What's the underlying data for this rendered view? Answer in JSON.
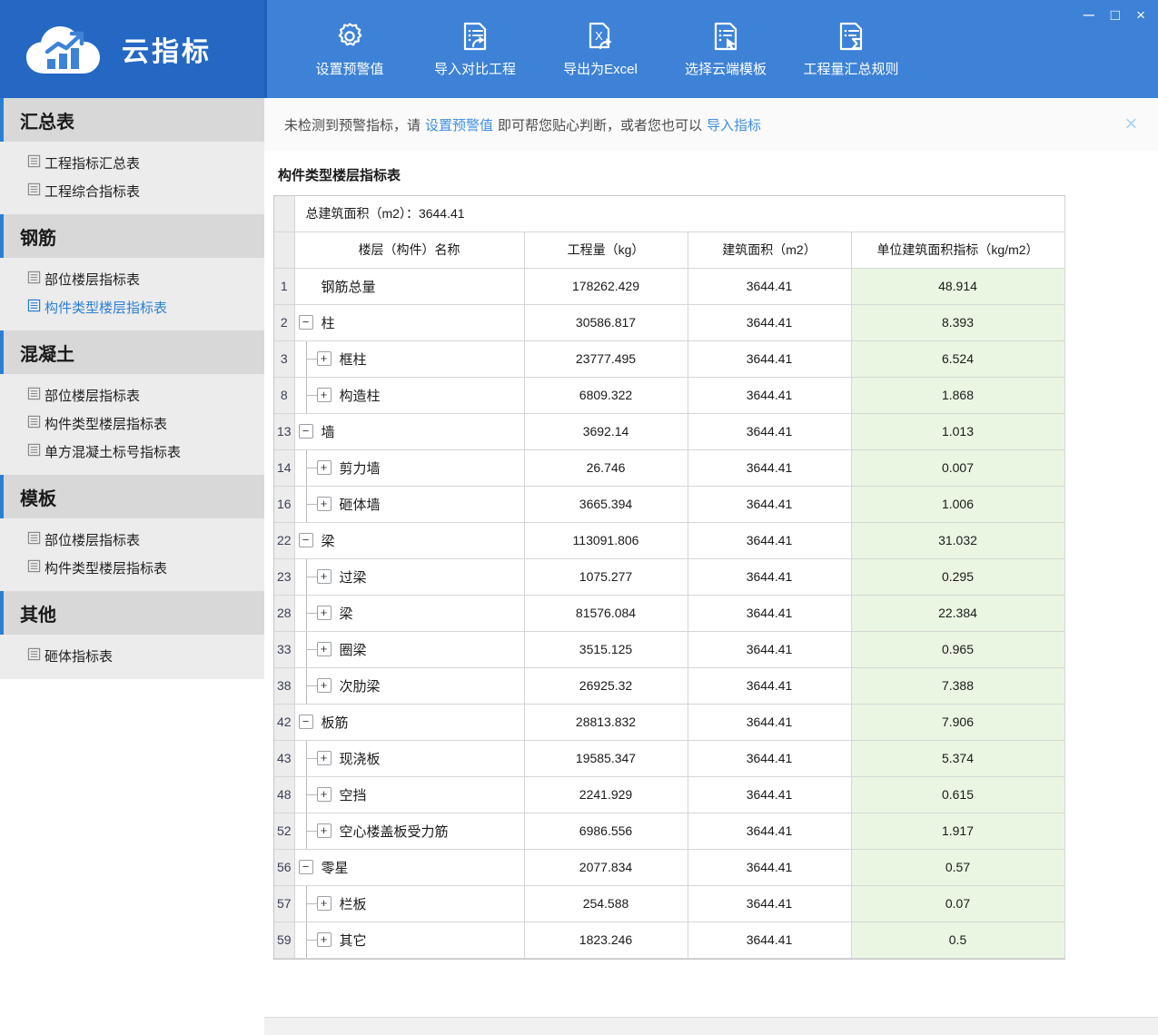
{
  "window": {
    "minimize_label": "─",
    "maximize_label": "□",
    "close_label": "×"
  },
  "brand": {
    "title": "云指标",
    "logo_icon": "cloud-chart-logo",
    "bg_color": "#2468c4"
  },
  "toolbar": {
    "bg_color": "#3d82d6",
    "items": [
      {
        "label": "设置预警值",
        "icon": "gear-icon"
      },
      {
        "label": "导入对比工程",
        "icon": "document-import-icon"
      },
      {
        "label": "导出为Excel",
        "icon": "excel-export-icon"
      },
      {
        "label": "选择云端模板",
        "icon": "document-cursor-icon"
      },
      {
        "label": "工程量汇总规则",
        "icon": "document-sigma-icon"
      }
    ]
  },
  "notice": {
    "text_1": "未检测到预警指标，请",
    "link_1": "设置预警值",
    "text_2": "即可帮您贴心判断，或者您也可以",
    "link_2": "导入指标",
    "close_label": "✕",
    "link_color": "#3f8fe0"
  },
  "sidebar": {
    "groups": [
      {
        "title": "汇总表",
        "items": [
          {
            "label": "工程指标汇总表",
            "active": false
          },
          {
            "label": "工程综合指标表",
            "active": false
          }
        ]
      },
      {
        "title": "钢筋",
        "items": [
          {
            "label": "部位楼层指标表",
            "active": false
          },
          {
            "label": "构件类型楼层指标表",
            "active": true
          }
        ]
      },
      {
        "title": "混凝土",
        "items": [
          {
            "label": "部位楼层指标表",
            "active": false
          },
          {
            "label": "构件类型楼层指标表",
            "active": false
          },
          {
            "label": "单方混凝土标号指标表",
            "active": false
          }
        ]
      },
      {
        "title": "模板",
        "items": [
          {
            "label": "部位楼层指标表",
            "active": false
          },
          {
            "label": "构件类型楼层指标表",
            "active": false
          }
        ]
      },
      {
        "title": "其他",
        "items": [
          {
            "label": "砸体指标表",
            "active": false
          }
        ]
      }
    ]
  },
  "main": {
    "panel_title": "构件类型楼层指标表",
    "summary_row": "总建筑面积（m2）：3644.41",
    "columns": [
      "楼层（构件）名称",
      "工程量（kg）",
      "建筑面积（m2）",
      "单位建筑面积指标（kg/m2）"
    ],
    "indicator_cell_color": "#eaf6e2",
    "rows": [
      {
        "no": "1",
        "level": 0,
        "expander": "",
        "name": "钢筋总量",
        "qty": "178262.429",
        "area": "3644.41",
        "indicator": "48.914"
      },
      {
        "no": "2",
        "level": 0,
        "expander": "−",
        "name": "柱",
        "qty": "30586.817",
        "area": "3644.41",
        "indicator": "8.393"
      },
      {
        "no": "3",
        "level": 1,
        "expander": "+",
        "name": "框柱",
        "qty": "23777.495",
        "area": "3644.41",
        "indicator": "6.524"
      },
      {
        "no": "8",
        "level": 1,
        "expander": "+",
        "name": "构造柱",
        "qty": "6809.322",
        "area": "3644.41",
        "indicator": "1.868"
      },
      {
        "no": "13",
        "level": 0,
        "expander": "−",
        "name": "墙",
        "qty": "3692.14",
        "area": "3644.41",
        "indicator": "1.013"
      },
      {
        "no": "14",
        "level": 1,
        "expander": "+",
        "name": "剪力墙",
        "qty": "26.746",
        "area": "3644.41",
        "indicator": "0.007"
      },
      {
        "no": "16",
        "level": 1,
        "expander": "+",
        "name": "砸体墙",
        "qty": "3665.394",
        "area": "3644.41",
        "indicator": "1.006"
      },
      {
        "no": "22",
        "level": 0,
        "expander": "−",
        "name": "梁",
        "qty": "113091.806",
        "area": "3644.41",
        "indicator": "31.032"
      },
      {
        "no": "23",
        "level": 1,
        "expander": "+",
        "name": "过梁",
        "qty": "1075.277",
        "area": "3644.41",
        "indicator": "0.295"
      },
      {
        "no": "28",
        "level": 1,
        "expander": "+",
        "name": "梁",
        "qty": "81576.084",
        "area": "3644.41",
        "indicator": "22.384"
      },
      {
        "no": "33",
        "level": 1,
        "expander": "+",
        "name": "圈梁",
        "qty": "3515.125",
        "area": "3644.41",
        "indicator": "0.965"
      },
      {
        "no": "38",
        "level": 1,
        "expander": "+",
        "name": "次肋梁",
        "qty": "26925.32",
        "area": "3644.41",
        "indicator": "7.388"
      },
      {
        "no": "42",
        "level": 0,
        "expander": "−",
        "name": "板筋",
        "qty": "28813.832",
        "area": "3644.41",
        "indicator": "7.906"
      },
      {
        "no": "43",
        "level": 1,
        "expander": "+",
        "name": "现浇板",
        "qty": "19585.347",
        "area": "3644.41",
        "indicator": "5.374"
      },
      {
        "no": "48",
        "level": 1,
        "expander": "+",
        "name": "空挡",
        "qty": "2241.929",
        "area": "3644.41",
        "indicator": "0.615"
      },
      {
        "no": "52",
        "level": 1,
        "expander": "+",
        "name": "空心楼盖板受力筋",
        "qty": "6986.556",
        "area": "3644.41",
        "indicator": "1.917"
      },
      {
        "no": "56",
        "level": 0,
        "expander": "−",
        "name": "零星",
        "qty": "2077.834",
        "area": "3644.41",
        "indicator": "0.57"
      },
      {
        "no": "57",
        "level": 1,
        "expander": "+",
        "name": "栏板",
        "qty": "254.588",
        "area": "3644.41",
        "indicator": "0.07"
      },
      {
        "no": "59",
        "level": 1,
        "expander": "+",
        "name": "其它",
        "qty": "1823.246",
        "area": "3644.41",
        "indicator": "0.5"
      }
    ]
  }
}
